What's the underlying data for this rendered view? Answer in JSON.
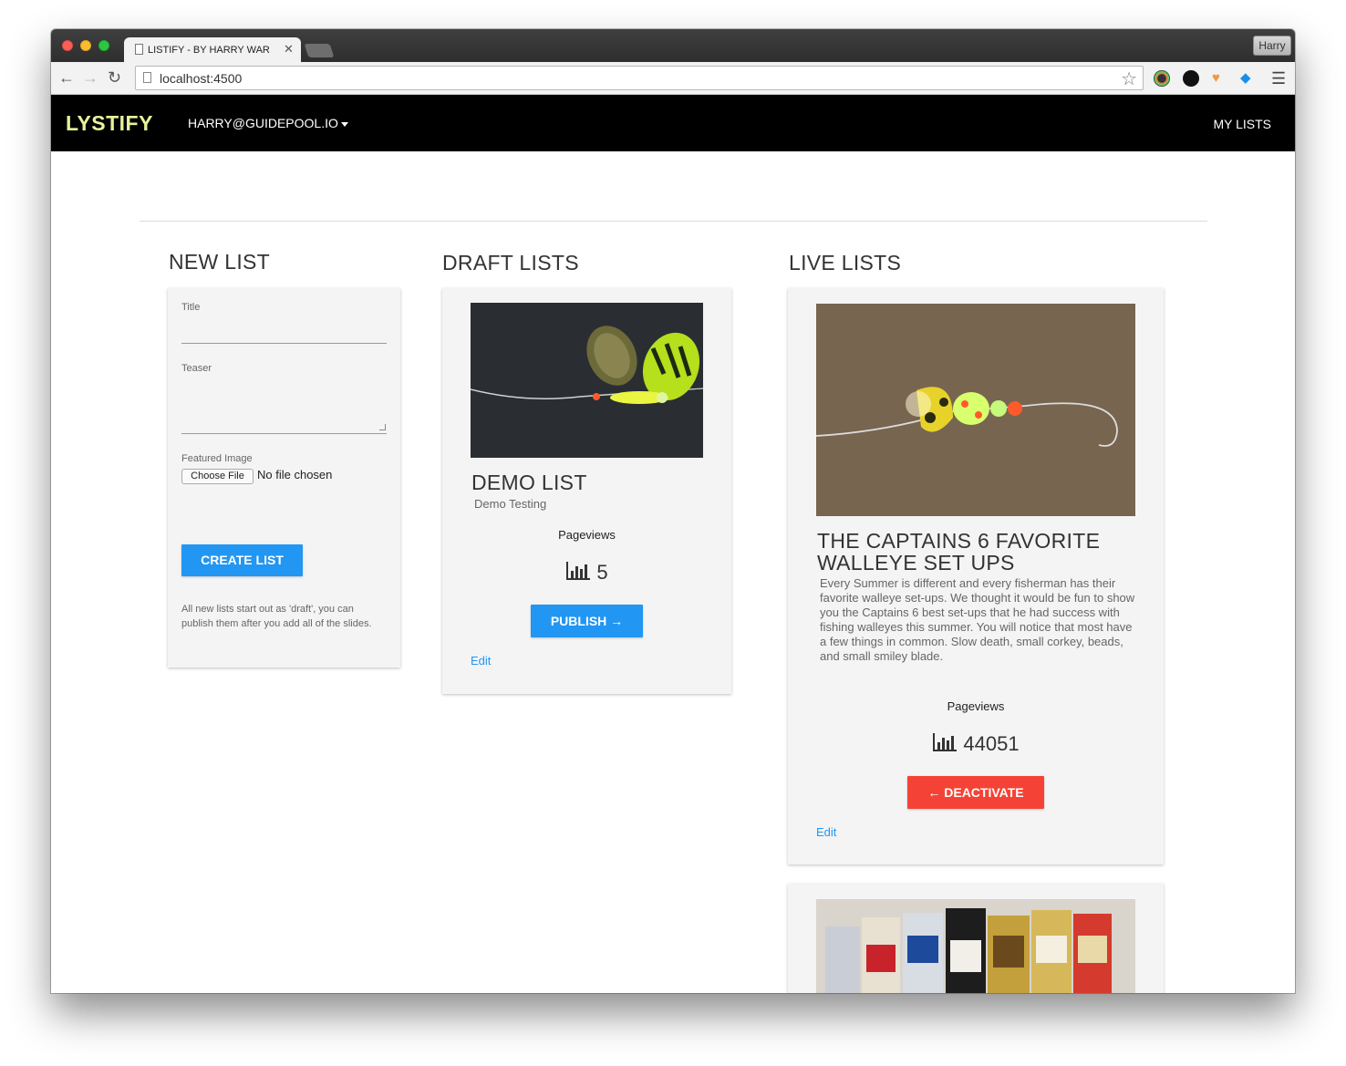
{
  "browser": {
    "tab_title": "LISTIFY - BY HARRY WAR",
    "profile": "Harry",
    "url": "localhost:4500"
  },
  "navbar": {
    "brand": "LYSTIFY",
    "user": "HARRY@GUIDEPOOL.IO",
    "my_lists": "MY LISTS"
  },
  "new_list": {
    "heading": "NEW LIST",
    "title_label": "Title",
    "teaser_label": "Teaser",
    "image_label": "Featured Image",
    "choose_file": "Choose File",
    "no_file": "No file chosen",
    "create_button": "CREATE LIST",
    "note": "All new lists start out as 'draft', you can publish them after you add all of the slides."
  },
  "draft_lists": {
    "heading": "DRAFT LISTS",
    "items": [
      {
        "title": "DEMO LIST",
        "subtitle": "Demo Testing",
        "pageviews_label": "Pageviews",
        "pageviews": "5",
        "action": "PUBLISH →",
        "edit": "Edit"
      }
    ]
  },
  "live_lists": {
    "heading": "LIVE LISTS",
    "items": [
      {
        "title": "THE CAPTAINS 6 FAVORITE WALLEYE SET UPS",
        "teaser": "Every Summer is different and every fisherman has their favorite walleye set-ups. We thought it would be fun to show you the Captains 6 best set-ups that he had success with fishing walleyes this summer.  You will notice that most have a few things in common. Slow death, small corkey, beads, and small smiley blade.",
        "pageviews_label": "Pageviews",
        "pageviews": "44051",
        "action": "← DEACTIVATE",
        "edit": "Edit"
      }
    ]
  },
  "colors": {
    "brand": "#e8f29a",
    "primary": "#2196f3",
    "danger": "#f44336",
    "navbar": "#000000"
  }
}
